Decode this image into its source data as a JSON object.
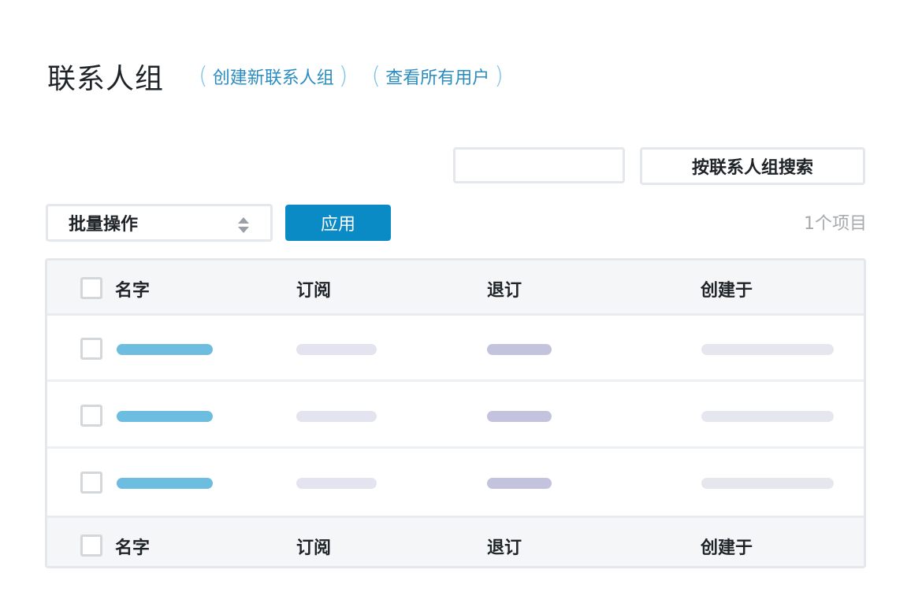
{
  "page": {
    "title": "联系人组",
    "links": [
      {
        "label": "创建新联系人组"
      },
      {
        "label": "查看所有用户"
      }
    ]
  },
  "search": {
    "placeholder": "",
    "value": "",
    "button_label": "按联系人组搜索"
  },
  "bulk": {
    "selected": "批量操作",
    "apply_label": "应用"
  },
  "item_count": "1个项目",
  "table": {
    "columns": [
      "名字",
      "订阅",
      "退订",
      "创建于"
    ],
    "footer_columns": [
      "名字",
      "订阅",
      "退订",
      "创建于"
    ],
    "row_count_placeholder": 3
  },
  "colors": {
    "accent": "#0a8bc6",
    "link": "#2a8cc0",
    "name_bar": "#6dbde0",
    "sub_bar": "#e3e4ef",
    "unsub_bar": "#c3c3de",
    "created_bar": "#e6e6ef"
  },
  "icons": {
    "select_arrows": "select-arrows-icon"
  }
}
